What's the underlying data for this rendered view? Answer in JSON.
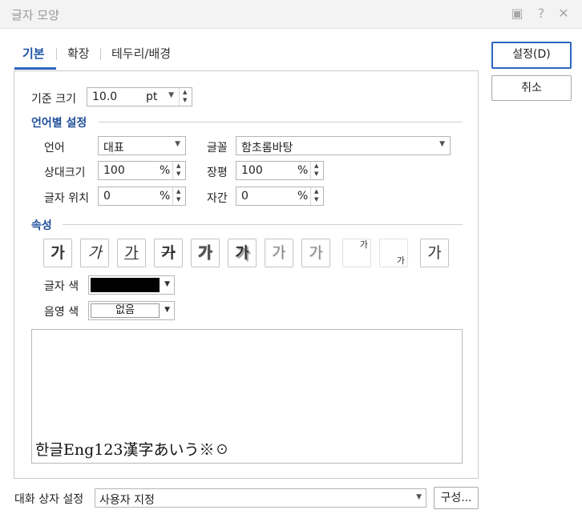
{
  "window": {
    "title": "글자 모양"
  },
  "tabs": [
    {
      "label": "기본"
    },
    {
      "label": "확장"
    },
    {
      "label": "테두리/배경"
    }
  ],
  "buttons": {
    "ok": "설정(D)",
    "cancel": "취소",
    "config": "구성..."
  },
  "basic": {
    "size_label": "기준 크기",
    "size_value": "10.0",
    "size_unit": "pt"
  },
  "lang_section": {
    "title": "언어별 설정",
    "language_label": "언어",
    "language_value": "대표",
    "font_label": "글꼴",
    "font_value": "함초롬바탕",
    "relsize_label": "상대크기",
    "relsize_value": "100",
    "width_label": "장평",
    "width_value": "100",
    "position_label": "글자 위치",
    "position_value": "0",
    "spacing_label": "자간",
    "spacing_value": "0",
    "percent": "%"
  },
  "attr_section": {
    "title": "속성",
    "buttons": [
      {
        "glyph": "가",
        "name": "bold"
      },
      {
        "glyph": "가",
        "name": "italic"
      },
      {
        "glyph": "가",
        "name": "underline"
      },
      {
        "glyph": "가",
        "name": "strikethrough"
      },
      {
        "glyph": "가",
        "name": "outline"
      },
      {
        "glyph": "가",
        "name": "shadow"
      },
      {
        "glyph": "가",
        "name": "emboss"
      },
      {
        "glyph": "가",
        "name": "engrave"
      },
      {
        "glyph": "가",
        "name": "superscript"
      },
      {
        "glyph": "가",
        "name": "subscript"
      },
      {
        "glyph": "가",
        "name": "normal"
      }
    ],
    "color_label": "글자 색",
    "text_color": "#000000",
    "shade_label": "음영 색",
    "shade_value": "없음"
  },
  "preview": {
    "text": "한글Eng123漢字あいう※☉"
  },
  "footer": {
    "dialog_setting_label": "대화 상자 설정",
    "dialog_setting_value": "사용자 지정"
  }
}
